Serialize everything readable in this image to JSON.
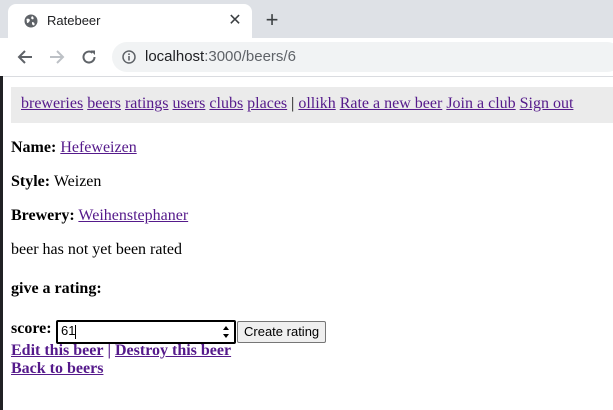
{
  "browser": {
    "tab_title": "Ratebeer",
    "tab_close": "✕",
    "new_tab": "+",
    "url_host": "localhost",
    "url_path": ":3000/beers/6"
  },
  "navbar": {
    "links": [
      "breweries",
      "beers",
      "ratings",
      "users",
      "clubs",
      "places"
    ],
    "separator": "|",
    "user": "ollikh",
    "rate_beer": "Rate a new beer",
    "join_club": "Join a club",
    "sign_out": "Sign out"
  },
  "beer": {
    "name_label": "Name:",
    "name": "Hefeweizen",
    "style_label": "Style:",
    "style": "Weizen",
    "brewery_label": "Brewery:",
    "brewery": "Weihenstephaner",
    "rating_status": "beer has not yet been rated"
  },
  "rating_form": {
    "heading": "give a rating:",
    "score_label": "score:",
    "score_value": "61",
    "submit_label": "Create rating"
  },
  "actions": {
    "edit": "Edit this beer",
    "separator": "|",
    "destroy": "Destroy this beer",
    "back": "Back to beers"
  }
}
